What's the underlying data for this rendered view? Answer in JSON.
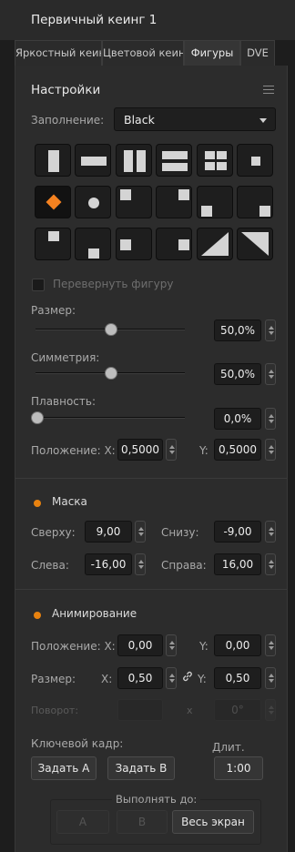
{
  "window": {
    "title": "Первичный кеинг 1"
  },
  "tabs": [
    {
      "label": "Яркостный кеинг",
      "active": false
    },
    {
      "label": "Цветовой кеинг",
      "active": false
    },
    {
      "label": "Фигуры",
      "active": true
    },
    {
      "label": "DVE",
      "active": false
    }
  ],
  "settings": {
    "heading": "Настройки",
    "fill_label": "Заполнение:",
    "fill_value": "Black",
    "shapes": [
      "rect-vertical-bar",
      "rect-horizontal-bar",
      "two-vertical-bars",
      "two-horizontal-bars",
      "four-boxes",
      "small-square-center",
      "diamond",
      "circle",
      "square-top-left",
      "square-top-right",
      "square-bottom-left",
      "square-bottom-right",
      "square-top-center",
      "square-bottom-center",
      "square-left-center",
      "square-right-center",
      "triangle-bottom-left",
      "triangle-top-right"
    ],
    "selected_shape": "diamond",
    "accent_color": "#f58220",
    "invert_label": "Перевернуть фигуру",
    "invert_checked": false,
    "size_label": "Размер:",
    "size_value": "50,0%",
    "size_level": 0.5,
    "symmetry_label": "Симметрия:",
    "symmetry_value": "50,0%",
    "symmetry_level": 0.5,
    "softness_label": "Плавность:",
    "softness_value": "0,0%",
    "softness_level": 0.0,
    "position_label": "Положение: X:",
    "position_x": "0,5000",
    "y_label": "Y:",
    "position_y": "0,5000"
  },
  "mask": {
    "heading": "Маска",
    "enabled_color": "#e8820f",
    "top_label": "Сверху:",
    "top_value": "9,00",
    "bottom_label": "Снизу:",
    "bottom_value": "-9,00",
    "left_label": "Слева:",
    "left_value": "-16,00",
    "right_label": "Справа:",
    "right_value": "16,00"
  },
  "animation": {
    "heading": "Анимирование",
    "position_label": "Положение: X:",
    "position_x": "0,00",
    "y_label": "Y:",
    "position_y": "0,00",
    "size_label": "Размер:",
    "x_label": "X:",
    "size_x": "0,50",
    "size_y_label": "Y:",
    "size_y": "0,50",
    "rotation_label": "Поворот:",
    "rotation_x_label": "x",
    "rotation_value": "0°",
    "keyframe_label": "Ключевой кадр:",
    "set_a": "Задать A",
    "set_b": "Задать B",
    "duration_label": "Длит.",
    "duration_value": "1:00",
    "run_to_label": "Выполнять до:",
    "run_a": "A",
    "run_b": "B",
    "run_full": "Весь экран"
  }
}
